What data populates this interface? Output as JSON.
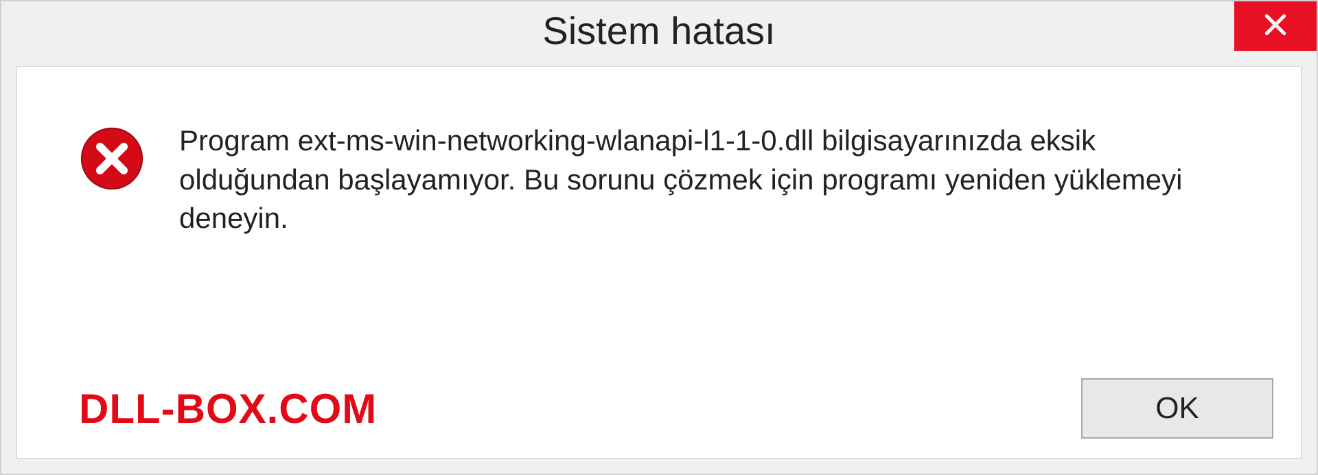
{
  "titlebar": {
    "title": "Sistem hatası"
  },
  "body": {
    "message": "Program ext-ms-win-networking-wlanapi-l1-1-0.dll bilgisayarınızda eksik olduğundan başlayamıyor. Bu sorunu çözmek için programı yeniden yüklemeyi deneyin."
  },
  "footer": {
    "watermark": "DLL-BOX.COM",
    "ok_label": "OK"
  },
  "icons": {
    "close": "close-icon",
    "error": "error-circle-x-icon"
  },
  "colors": {
    "close_bg": "#e81123",
    "error_red": "#d40b16",
    "watermark_red": "#e20a17",
    "panel_bg": "#f0f0f0"
  }
}
